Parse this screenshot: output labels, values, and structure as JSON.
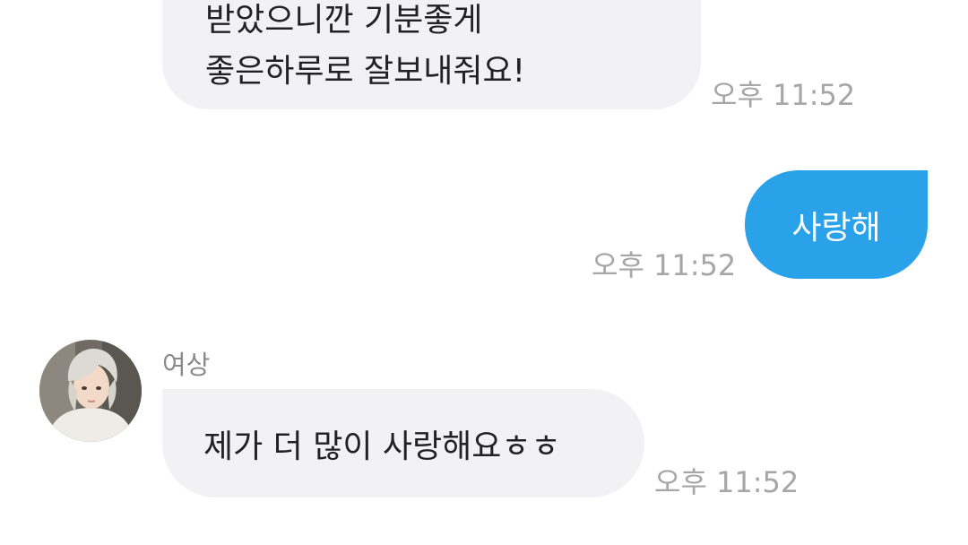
{
  "messages": [
    {
      "direction": "incoming",
      "lines": [
        "받았으니깐 기분좋게",
        "좋은하루로 잘보내줘요!"
      ],
      "time": "오후 11:52"
    },
    {
      "direction": "outgoing",
      "text": "사랑해",
      "time": "오후 11:52"
    },
    {
      "direction": "incoming",
      "sender": "여상",
      "avatar_icon": "profile-photo",
      "text": "제가 더 많이 사랑해요ㅎㅎ",
      "time": "오후 11:52"
    }
  ],
  "colors": {
    "incoming_bubble": "#f2f2f5",
    "outgoing_bubble": "#2aa2ea",
    "timestamp": "#a6a6a6"
  }
}
